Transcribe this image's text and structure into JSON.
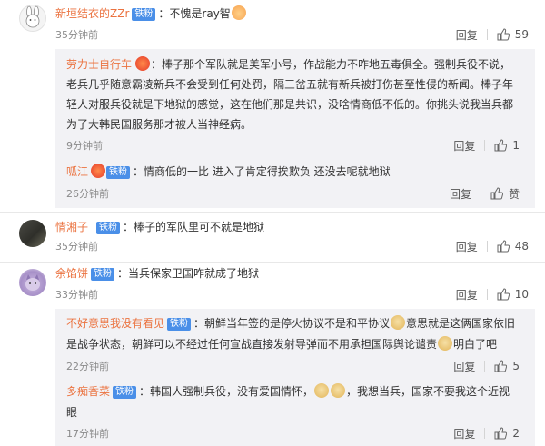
{
  "comments": [
    {
      "user": "新垣结衣的ZZr",
      "badge": "铁粉",
      "text": "不愧是ray智",
      "time": "35分钟前",
      "reply_label": "回复",
      "likes": "59",
      "replies": [
        {
          "user": "劳力士自行车",
          "badge": "",
          "text_lines": [
            "：棒子那个军队就是美军小号，作战能力不咋地五毒俱全。强制兵役不说，",
            "老兵几乎随意霸凌新兵不会受到任何处罚，隔三岔五就有新兵被打伤甚至性侵的新闻。棒子年",
            "轻人对服兵役就是下地狱的感觉，这在他们那是共识，没啥情商低不低的。你挑头说我当兵都",
            "为了大韩民国服务那才被人当神经病。"
          ],
          "time": "9分钟前",
          "reply_label": "回复",
          "likes": "1"
        },
        {
          "user": "呱江",
          "badge": "铁粉",
          "text": "：情商低的一比 进入了肯定得挨欺负 还没去呢就地狱",
          "time": "26分钟前",
          "reply_label": "回复",
          "likes": "赞"
        }
      ]
    },
    {
      "user": "情湘子_",
      "badge": "铁粉",
      "text": "：棒子的军队里可不就是地狱",
      "time": "35分钟前",
      "reply_label": "回复",
      "likes": "48",
      "replies": []
    },
    {
      "user": "余馅饼",
      "badge": "铁粉",
      "text": "：当兵保家卫国咋就成了地狱",
      "time": "33分钟前",
      "reply_label": "回复",
      "likes": "10",
      "replies": [
        {
          "user": "不好意思我没有看见",
          "badge": "铁粉",
          "text_lines": [
            "：朝鲜当年签的是停火协议不是和平协议",
            "意思就是这俩国家依旧",
            "是战争状态，朝鲜可以不经过任何宣战直接发射导弹而不用承担国际舆论谴责",
            "明白了吧"
          ],
          "time": "22分钟前",
          "reply_label": "回复",
          "likes": "5"
        },
        {
          "user": "多痴香菜",
          "badge": "铁粉",
          "text_lines": [
            "：韩国人强制兵役，没有爱国情怀，",
            "，我想当兵，国家不要我这个近视",
            "眼"
          ],
          "time": "17分钟前",
          "reply_label": "回复",
          "likes": "2"
        }
      ]
    }
  ],
  "colors": {
    "username": "#eb7340",
    "badge_bg": "#4a8fe8",
    "reply_bg": "#f2f2f5",
    "time": "#8b8b8b"
  },
  "icons": {
    "like": "thumbs-up-icon",
    "emoji_1": "medal-emoji-icon",
    "emoji_2": "laughing-emoji-icon",
    "emoji_3": "doge-emoji-icon"
  }
}
